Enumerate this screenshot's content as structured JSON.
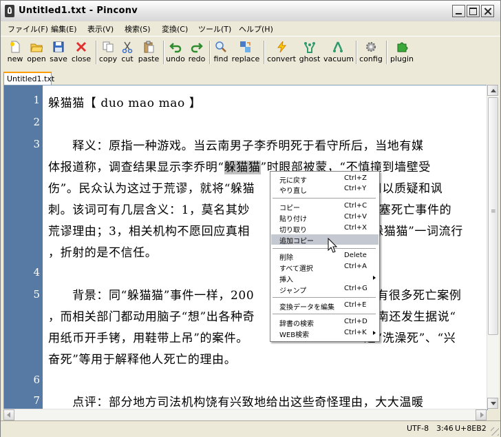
{
  "window": {
    "title": "Untitled1.txt - Pinconv"
  },
  "menu": [
    "ファイル(F)",
    "編集(E)",
    "表示(V)",
    "検索(S)",
    "変換(C)",
    "ツール(T)",
    "ヘルプ(H)"
  ],
  "toolbar": {
    "new": "new",
    "open": "open",
    "save": "save",
    "close": "close",
    "copy": "copy",
    "cut": "cut",
    "paste": "paste",
    "undo": "undo",
    "redo": "redo",
    "find": "find",
    "replace": "replace",
    "convert": "convert",
    "ghost": "ghost",
    "vacuum": "vacuum",
    "config": "config",
    "plugin": "plugin"
  },
  "tab": {
    "label": "Untitled1.txt"
  },
  "line_numbers": [
    "1",
    "2",
    "3",
    "",
    "",
    "",
    "",
    "",
    "4",
    "5",
    "",
    "",
    "",
    "6",
    "7"
  ],
  "editor_lines": {
    "l1": "躲猫猫【 duo mao mao 】",
    "l3a": "　　释义：原指一种游戏。当云南男子李乔明死于看守所后，当地有媒",
    "l3b_pre": "体报道称，调查结果显示李乔明“",
    "l3b_sel": "躲猫猫",
    "l3b_post": "”时眼部被蒙，“不慎撞到墙壁受",
    "l3c_pre": "伤”。民众认为这过于荒谬，就将“躲猫",
    "l3c_post": "汇用以质疑和讽",
    "l3d_pre": "刺。该词可有几层含义：1，莫名其妙",
    "l3d_post": "搪塞死亡事件的",
    "l3e_pre": "荒谬理由；3，相关机构不愿回应真相",
    "l3e_post": "“躲猫猫”一词流行",
    "l3f": "，折射的是不信任。",
    "l5a_pre": "　　背景：同“躲猫猫”事件一样，200",
    "l5a_post": "有很多死亡案例",
    "l5b_pre": "，而相关部门都动用脑子“想”出各种奇",
    "l5b_post": "云南还发生据说“",
    "l5c_pre": "用纸币开手铐，用鞋带上吊”的案件。",
    "l5c_post": "过“洗澡死”、“兴",
    "l5d": "奋死”等用于解释他人死亡的理由。",
    "l7": "　　点评：部分地方司法机构饶有兴致地给出这些奇怪理由，大大温暖"
  },
  "context_menu": [
    {
      "label": "元に戻す",
      "shortcut": "Ctrl+Z"
    },
    {
      "label": "やり直し",
      "shortcut": "Ctrl+Y"
    },
    {
      "label": "コピー",
      "shortcut": "Ctrl+C"
    },
    {
      "label": "貼り付け",
      "shortcut": "Ctrl+V"
    },
    {
      "label": "切り取り",
      "shortcut": "Ctrl+X"
    },
    {
      "label": "追加コピー",
      "shortcut": ""
    },
    {
      "label": "削除",
      "shortcut": "Delete"
    },
    {
      "label": "すべて選択",
      "shortcut": "Ctrl+A"
    },
    {
      "label": "挿入",
      "shortcut": ""
    },
    {
      "label": "ジャンプ",
      "shortcut": "Ctrl+G"
    },
    {
      "label": "変換データを編集",
      "shortcut": "Ctrl+E"
    },
    {
      "label": "辞書の検索",
      "shortcut": "Ctrl+D"
    },
    {
      "label": "WEB検索",
      "shortcut": "Ctrl+K"
    }
  ],
  "status": {
    "encoding": "UTF-8",
    "position": "3:46",
    "unicode": "U+8EB2"
  },
  "colors": {
    "gutter": "#567aa4",
    "tab_accent": "#ff9c00",
    "selection": "#c0c0c0",
    "menu_highlight": "#c4c8d0"
  }
}
